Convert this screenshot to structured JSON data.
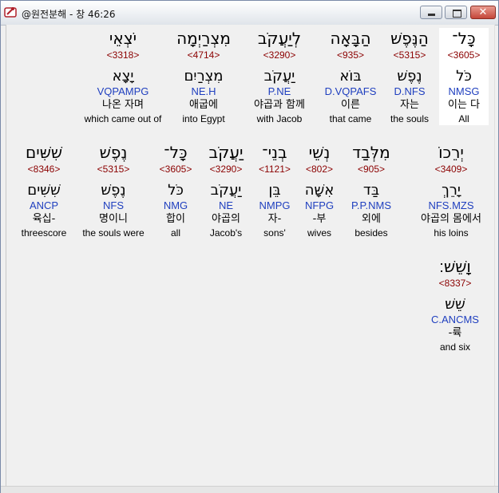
{
  "window": {
    "title": "@원전분해 - 창 46:26",
    "buttons": {
      "minimize": "minimize",
      "maximize": "maximize",
      "close": "✕"
    }
  },
  "rows": [
    {
      "words": [
        {
          "heb": "כָּל־",
          "strong": "<3605>",
          "lemma": "כֹּל",
          "morph": "NMSG",
          "kor": "이는 다",
          "eng": "All",
          "selected": true
        },
        {
          "heb": "הַנֶּפֶשׁ",
          "strong": "<5315>",
          "lemma": "נֶפֶשׁ",
          "morph": "D.NFS",
          "kor": "자는",
          "eng": "the souls"
        },
        {
          "heb": "הַבָּאָה",
          "strong": "<935>",
          "lemma": "בּוֹא",
          "morph": "D.VQPAFS",
          "kor": "이른",
          "eng": "that came"
        },
        {
          "heb": "לְיַעֲקֹב",
          "strong": "<3290>",
          "lemma": "יַעֲקֹב",
          "morph": "P.NE",
          "kor": "야곱과 함께",
          "eng": "with Jacob"
        },
        {
          "heb": "מִצְרַיְמָה",
          "strong": "<4714>",
          "lemma": "מִצְרַיִם",
          "morph": "NE.H",
          "kor": "애굽에",
          "eng": "into Egypt"
        },
        {
          "heb": "יֹצְאֵי",
          "strong": "<3318>",
          "lemma": "יָצָא",
          "morph": "VQPAMPG",
          "kor": "나온 자며",
          "eng": "which came out of"
        }
      ]
    },
    {
      "words": [
        {
          "heb": "יְרֵכוֹ",
          "strong": "<3409>",
          "lemma": "יָרֵךְ",
          "morph": "NFS.MZS",
          "kor": "야곱의 몸에서",
          "eng": "his loins"
        },
        {
          "heb": "מִלְּבַד",
          "strong": "<905>",
          "lemma": "בַּד",
          "morph": "P.P.NMS",
          "kor": "외에",
          "eng": "besides"
        },
        {
          "heb": "נְשֵׁי",
          "strong": "<802>",
          "lemma": "אִשָּׁה",
          "morph": "NFPG",
          "kor": "-부",
          "eng": "wives"
        },
        {
          "heb": "בְנֵי־",
          "strong": "<1121>",
          "lemma": "בֵּן",
          "morph": "NMPG",
          "kor": "자-",
          "eng": "sons'"
        },
        {
          "heb": "יַעֲקֹב",
          "strong": "<3290>",
          "lemma": "יַעֲקֹב",
          "morph": "NE",
          "kor": "야곱의",
          "eng": "Jacob's"
        },
        {
          "heb": "כָּל־",
          "strong": "<3605>",
          "lemma": "כֹּל",
          "morph": "NMG",
          "kor": "합이",
          "eng": "all"
        },
        {
          "heb": "נֶפֶשׁ",
          "strong": "<5315>",
          "lemma": "נֶפֶשׁ",
          "morph": "NFS",
          "kor": "명이니",
          "eng": "the souls were"
        },
        {
          "heb": "שִׁשִּׁים",
          "strong": "<8346>",
          "lemma": "שִׁשִּׁים",
          "morph": "ANCP",
          "kor": "육십-",
          "eng": "threescore"
        }
      ]
    },
    {
      "words": [
        {
          "heb": "וָשֵׁשׁ׃",
          "strong": "<8337>",
          "lemma": "שֵׁשׁ",
          "morph": "C.ANCMS",
          "kor": "-륙",
          "eng": "and six"
        }
      ]
    }
  ]
}
